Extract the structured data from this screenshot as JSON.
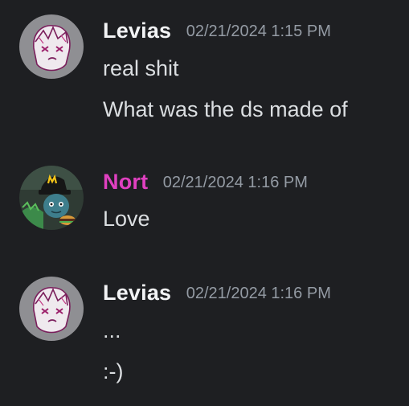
{
  "messages": [
    {
      "username": "Levias",
      "username_color": "#f2f3f5",
      "timestamp": "02/21/2024 1:15 PM",
      "avatar_icon": "levias-avatar",
      "lines": [
        "real shit",
        "What was the ds made of"
      ]
    },
    {
      "username": "Nort",
      "username_color": "#e040c0",
      "timestamp": "02/21/2024 1:16 PM",
      "avatar_icon": "nort-avatar",
      "lines": [
        "Love"
      ]
    },
    {
      "username": "Levias",
      "username_color": "#f2f3f5",
      "timestamp": "02/21/2024 1:16 PM",
      "avatar_icon": "levias-avatar",
      "lines": [
        "...",
        ":-)"
      ]
    }
  ],
  "theme": {
    "background": "#1e1f22",
    "text": "#dbdee1",
    "muted": "#949ba4"
  }
}
